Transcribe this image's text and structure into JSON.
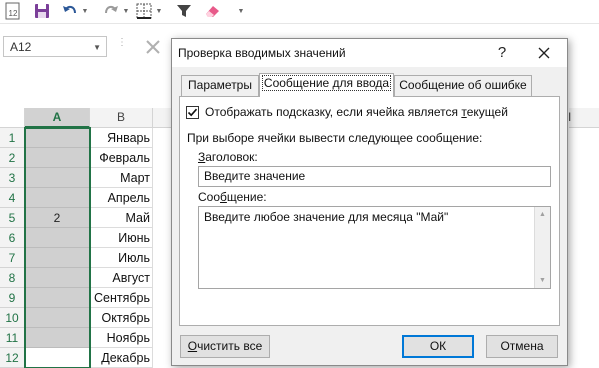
{
  "toolbar": {
    "excel_icon_number": "12",
    "icons": [
      "excel-icon",
      "save-icon",
      "undo-icon",
      "redo-icon",
      "border-icon",
      "filter-icon",
      "eraser-icon"
    ]
  },
  "formula_bar": {
    "name_box": "A12"
  },
  "grid": {
    "columns": [
      "A",
      "B"
    ],
    "partial_column": "I",
    "rows": [
      {
        "num": "1",
        "a": "",
        "b": "Январь"
      },
      {
        "num": "2",
        "a": "",
        "b": "Февраль"
      },
      {
        "num": "3",
        "a": "",
        "b": "Март"
      },
      {
        "num": "4",
        "a": "",
        "b": "Апрель"
      },
      {
        "num": "5",
        "a": "2",
        "b": "Май"
      },
      {
        "num": "6",
        "a": "",
        "b": "Июнь"
      },
      {
        "num": "7",
        "a": "",
        "b": "Июль"
      },
      {
        "num": "8",
        "a": "",
        "b": "Август"
      },
      {
        "num": "9",
        "a": "",
        "b": "Сентябрь"
      },
      {
        "num": "10",
        "a": "",
        "b": "Октябрь"
      },
      {
        "num": "11",
        "a": "",
        "b": "Ноябрь"
      },
      {
        "num": "12",
        "a": "",
        "b": "Декабрь"
      }
    ]
  },
  "dialog": {
    "title": "Проверка вводимых значений",
    "help": "?",
    "tabs": [
      "Параметры",
      "Сообщение для ввода",
      "Сообщение об ошибке"
    ],
    "active_tab": "Сообщение для ввода",
    "show_hint_checkbox": {
      "label_pre": "Отображать подсказку, если ячейка является ",
      "label_hotkey": "т",
      "label_post": "екущей",
      "checked": true
    },
    "when_selected_label": "При выборе ячейки вывести следующее сообщение:",
    "title_field": {
      "label_hotkey": "З",
      "label_rest": "аголовок:",
      "value": "Введите значение"
    },
    "message_field": {
      "label_pre": "Соо",
      "label_hotkey": "б",
      "label_post": "щение:",
      "value": "Введите любое значение для месяца \"Май\""
    },
    "clear_button": {
      "hotkey": "О",
      "rest": "чистить все"
    },
    "ok_label": "ОК",
    "cancel_label": "Отмена"
  },
  "colors": {
    "excel_green": "#217346",
    "selection_fill": "#d0d0d0",
    "dialog_bg": "#f0f0f0",
    "accent_blue": "#0078d7"
  }
}
